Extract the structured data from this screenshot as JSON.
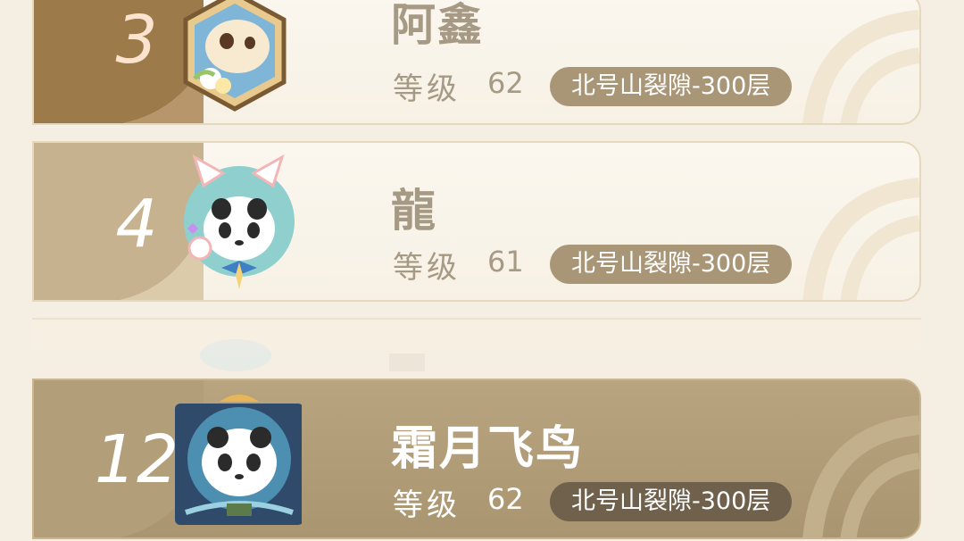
{
  "colors": {
    "page_bg": "#f5efe3",
    "gold_rank": "#9c7a4a",
    "tan_rank": "#c7b28f",
    "pill_bg": "#a89677",
    "pill_dark_bg": "#6f614c",
    "name_light": "#a79a85",
    "name_dark": "#ffffff",
    "level_light": "#a79a85"
  },
  "rows": [
    {
      "rank": "3",
      "name": "阿鑫",
      "level_label": "等级",
      "level": "62",
      "stage": "北号山裂隙-300层",
      "avatar_icon": "cat-avatar-icon"
    },
    {
      "rank": "4",
      "name": "龍",
      "level_label": "等级",
      "level": "61",
      "stage": "北号山裂隙-300层",
      "avatar_icon": "panda-cat-avatar-icon"
    },
    {
      "rank": "12",
      "name": "霜月飞鸟",
      "level_label": "等级",
      "level": "62",
      "stage": "北号山裂隙-300层",
      "avatar_icon": "panda-avatar-icon"
    }
  ]
}
